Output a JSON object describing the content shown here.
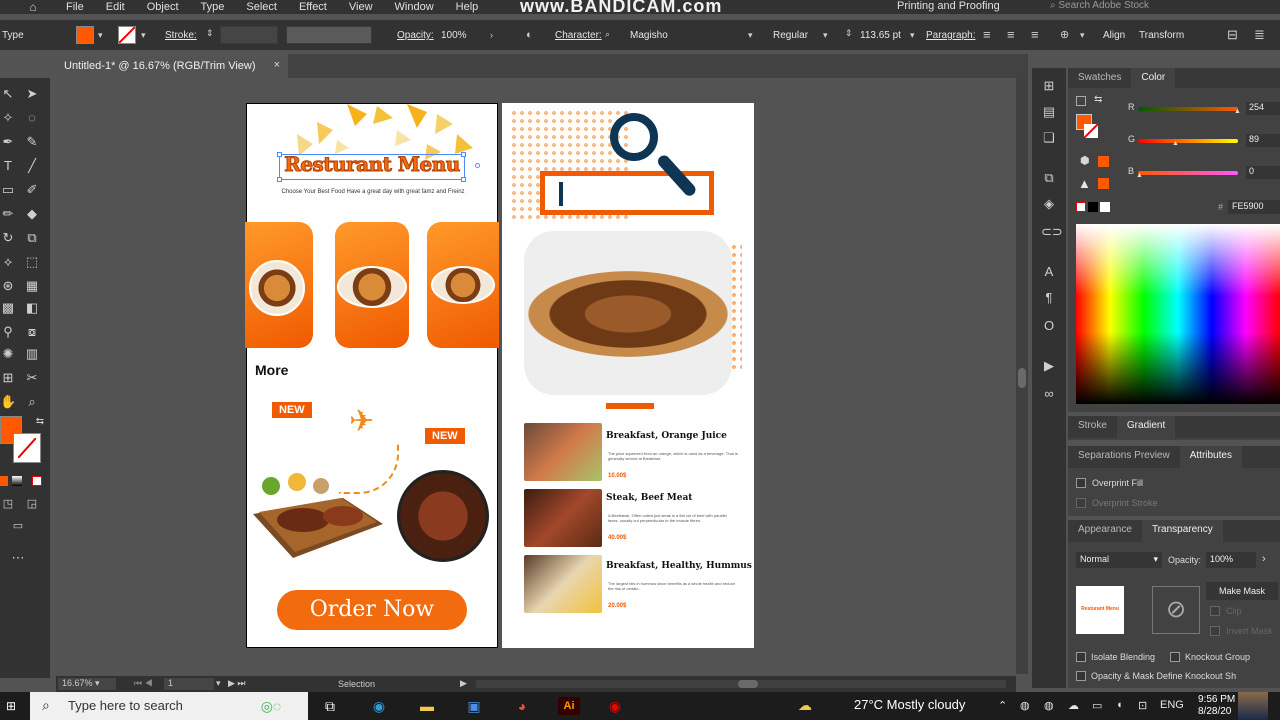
{
  "menubar": {
    "items": [
      "File",
      "Edit",
      "Object",
      "Type",
      "Select",
      "Effect",
      "View",
      "Window",
      "Help"
    ],
    "watermark": "www.BANDICAM.com",
    "workspace": "Printing and Proofing",
    "search_placeholder": "Search Adobe Stock"
  },
  "control_bar": {
    "mode_label": "Type",
    "stroke_label": "Stroke:",
    "opacity_label": "Opacity:",
    "opacity_value": "100%",
    "character_label": "Character:",
    "font_family": "Magisho",
    "font_style": "Regular",
    "font_size": "113.65 pt",
    "paragraph_label": "Paragraph:",
    "align_label": "Align",
    "transform_label": "Transform",
    "fill_color": "#FE5900"
  },
  "document": {
    "tab_title": "Untitled-1* @ 16.67% (RGB/Trim View)",
    "close_glyph": "×"
  },
  "artboard1": {
    "title": "Resturant Menu",
    "subtitle": "Choose Your Best Food Have a great day with great famz and Freinz",
    "section_label": "More",
    "badge1": "NEW",
    "badge2": "NEW",
    "cta": "Order Now"
  },
  "artboard2": {
    "items": [
      {
        "title": "Breakfast, Orange Juice",
        "desc": "The juice squeezed from an orange, which is used as a beverage. That is generally served at Breakfast.",
        "price": "10.00$"
      },
      {
        "title": "Steak, Beef Meat",
        "desc": "A Beefsteak, Often called just steak is a flat cut of beef with parallel faces, usually cut perpendicular to the muscle fibres.",
        "price": "40.00$"
      },
      {
        "title": "Breakfast, Healthy, Hummus",
        "desc": "The largest hits in hummus since benefits as a whole health and reduce the risk of certain.",
        "price": "20.00$"
      }
    ]
  },
  "color_panel": {
    "tabs": [
      "Swatches",
      "Color"
    ],
    "r_label": "R",
    "r_value": "254",
    "g_label": "G",
    "g_value": "89",
    "b_label": "B",
    "b_value": "0",
    "hex": "FE5900"
  },
  "stroke_panel": {
    "tabs": [
      "Stroke",
      "Gradient"
    ]
  },
  "attributes_panel": {
    "tabs": [
      "Separations Preview",
      "Attributes"
    ],
    "overprint_fill": "Overprint Fill",
    "overprint_stroke": "Overprint Stroke"
  },
  "transparency_panel": {
    "tabs": [
      "Appearance",
      "Transparency"
    ],
    "blend_mode": "Normal",
    "opacity_label": "Opacity:",
    "opacity_value": "100%",
    "make_mask": "Make Mask",
    "clip": "Clip",
    "invert_mask": "Invert Mask",
    "isolate_blending": "Isolate Blending",
    "knockout_group": "Knockout Group",
    "opacity_mask": "Opacity & Mask Define Knockout Sh",
    "thumb_text": "Resturant Menu"
  },
  "status_bar": {
    "zoom": "16.67%",
    "artboard_num": "1",
    "tool": "Selection"
  },
  "taskbar": {
    "search_placeholder": "Type here to search",
    "weather": "27°C  Mostly cloudy",
    "language": "ENG",
    "time": "9:56 PM",
    "date": "8/28/20"
  },
  "colors": {
    "accent": "#FE5900",
    "navy": "#0E3553"
  }
}
